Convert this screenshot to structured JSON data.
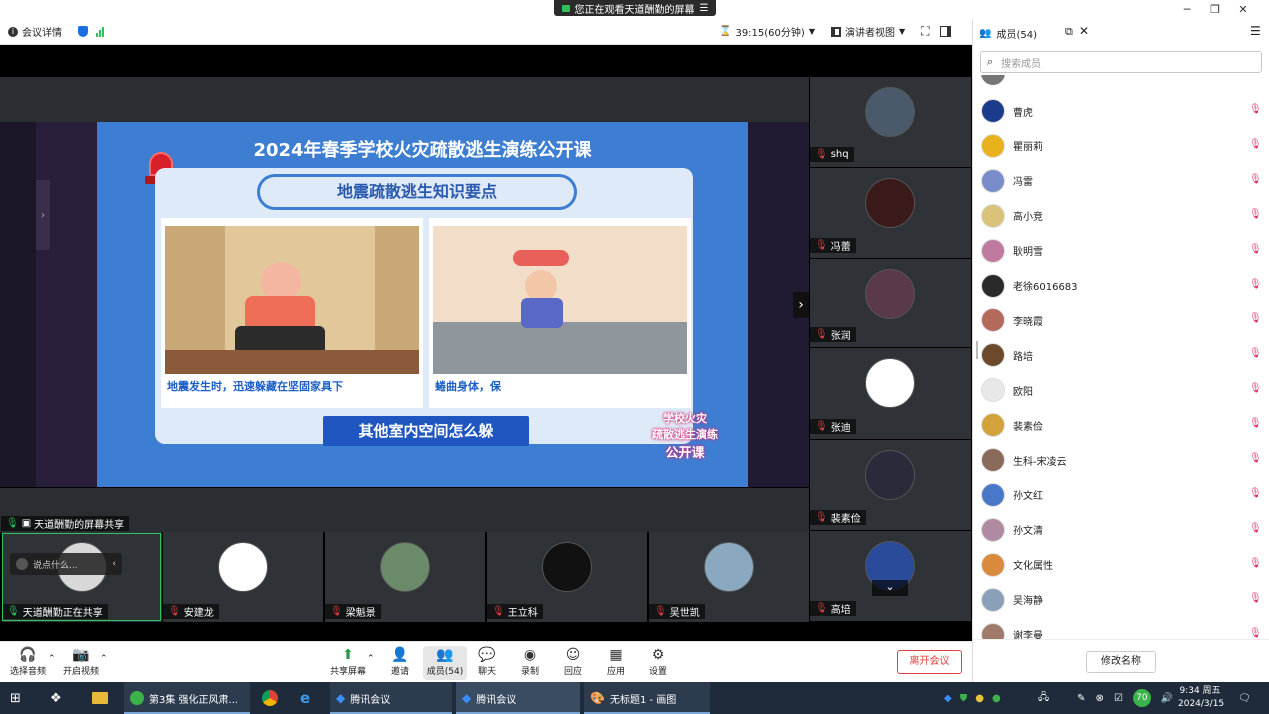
{
  "banner": {
    "text": "您正在观看天道酬勤的屏幕"
  },
  "toolbar": {
    "meeting_info": "会议详情",
    "timer": "39:15(60分钟)",
    "view": "演讲者视图"
  },
  "panel": {
    "title": "成员(54)",
    "search_placeholder": "搜索成员",
    "rename": "修改名称",
    "members": [
      {
        "name": "曹虎",
        "color": "#1b3c8c"
      },
      {
        "name": "瞿丽莉",
        "color": "#e8b21c"
      },
      {
        "name": "冯雷",
        "color": "#7a8cc9"
      },
      {
        "name": "高小竞",
        "color": "#d9c27a"
      },
      {
        "name": "耿明雪",
        "color": "#c07aa0"
      },
      {
        "name": "老徐6016683",
        "color": "#2a2a2a"
      },
      {
        "name": "李晓霞",
        "color": "#b46a5a"
      },
      {
        "name": "路培",
        "color": "#6a4a2a"
      },
      {
        "name": "欧阳",
        "color": "#e8e8e8"
      },
      {
        "name": "裴素俭",
        "color": "#d4a23a"
      },
      {
        "name": "生科-宋凌云",
        "color": "#8a6a5a"
      },
      {
        "name": "孙文红",
        "color": "#4a78c9"
      },
      {
        "name": "孙文清",
        "color": "#b08aa0"
      },
      {
        "name": "文化属性",
        "color": "#d98a3a"
      },
      {
        "name": "吴海静",
        "color": "#8aa0b8"
      },
      {
        "name": "谢李曼",
        "color": "#a07a6a"
      }
    ]
  },
  "slide": {
    "title": "2024年春季学校火灾疏散逃生演练公开课",
    "subtitle": "地震疏散逃生知识要点",
    "cap1": "地震发生时，迅速躲藏在坚固家具下",
    "cap2": "蜷曲身体，保",
    "bottom": "其他室内空间怎么躲",
    "stamp1": "学校火灾",
    "stamp2": "疏散逃生演练",
    "stamp3": "公开课"
  },
  "side_tiles": [
    {
      "name": "shq",
      "color": "#4a5a6a"
    },
    {
      "name": "冯蕾",
      "color": "#3a1a1a"
    },
    {
      "name": "张润",
      "color": "#5a3a4a"
    },
    {
      "name": "张迪",
      "color": "#ffffff"
    },
    {
      "name": "裴素俭",
      "color": "#2a2a3a"
    },
    {
      "name": "高培",
      "color": "#2a4a9a"
    }
  ],
  "bottom_tiles": [
    {
      "name": "天道酬勤正在共享",
      "color": "#d8d8d8"
    },
    {
      "name": "安建龙",
      "color": "#ffffff"
    },
    {
      "name": "梁魁景",
      "color": "#6a8a6a"
    },
    {
      "name": "王立科",
      "color": "#111111"
    },
    {
      "name": "吴世凯",
      "color": "#8aa9c0"
    }
  ],
  "share_label": "天道酬勤的屏幕共享",
  "chat_placeholder": "说点什么...",
  "bottom_bar": {
    "audio": "选择音频",
    "video": "开启视频",
    "share": "共享屏幕",
    "invite": "邀请",
    "members": "成员(54)",
    "chat": "聊天",
    "record": "录制",
    "reply": "回应",
    "apps": "应用",
    "settings": "设置",
    "leave": "离开会议"
  },
  "taskbar": {
    "item1": "第3集 强化正风肃...",
    "item2": "腾讯会议",
    "item3": "腾讯会议",
    "item4": "无标题1 - 画图",
    "time": "9:34 周五",
    "date": "2024/3/15",
    "badge": "70"
  }
}
